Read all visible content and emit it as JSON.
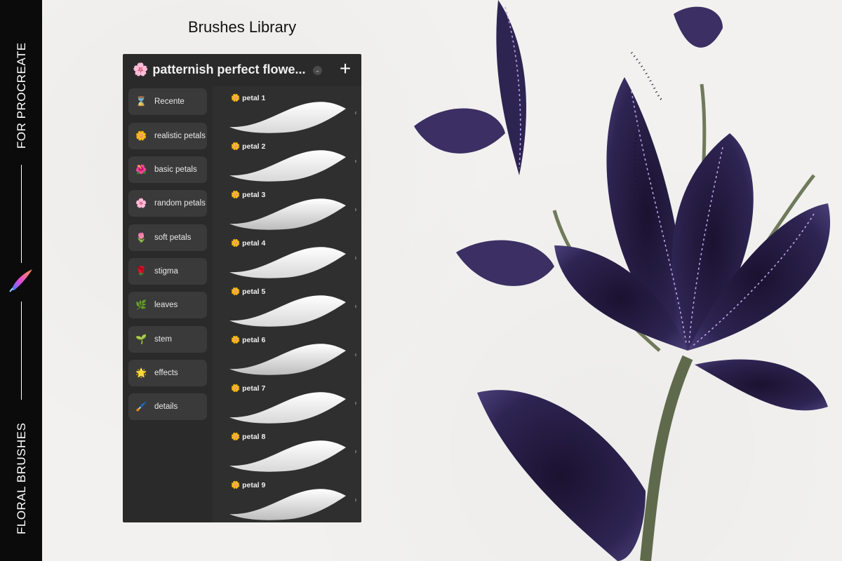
{
  "side_strip": {
    "top_text": "FOR PROCREATE",
    "bottom_text": "FLORAL BRUSHES"
  },
  "caption": "Brushes Library",
  "panel": {
    "title_emoji": "🌸",
    "title": "patternish perfect flowe...",
    "plus_label": "+",
    "sidebar": [
      {
        "icon": "⌛",
        "label": "Recente"
      },
      {
        "icon": "🌼",
        "label": "realistic petals"
      },
      {
        "icon": "🌺",
        "label": "basic petals"
      },
      {
        "icon": "🌸",
        "label": "random petals"
      },
      {
        "icon": "🌷",
        "label": "soft petals"
      },
      {
        "icon": "🌹",
        "label": "stigma"
      },
      {
        "icon": "🌿",
        "label": "leaves"
      },
      {
        "icon": "🌱",
        "label": "stem"
      },
      {
        "icon": "🌟",
        "label": "effects"
      },
      {
        "icon": "🖌️",
        "label": "details"
      }
    ],
    "brushes": [
      {
        "icon": "🌼",
        "name": "petal 1"
      },
      {
        "icon": "🌼",
        "name": "petal 2"
      },
      {
        "icon": "🌼",
        "name": "petal 3"
      },
      {
        "icon": "🌼",
        "name": "petal 4"
      },
      {
        "icon": "🌼",
        "name": "petal 5"
      },
      {
        "icon": "🌼",
        "name": "petal 6"
      },
      {
        "icon": "🌼",
        "name": "petal 7"
      },
      {
        "icon": "🌼",
        "name": "petal 8"
      },
      {
        "icon": "🌼",
        "name": "petal 9"
      }
    ]
  },
  "colors": {
    "panel_bg": "#2a2a2a",
    "flower_purple": "#2d2150",
    "stem_green": "#6f7a5a",
    "stitch_lavender": "#b9a6e8"
  }
}
